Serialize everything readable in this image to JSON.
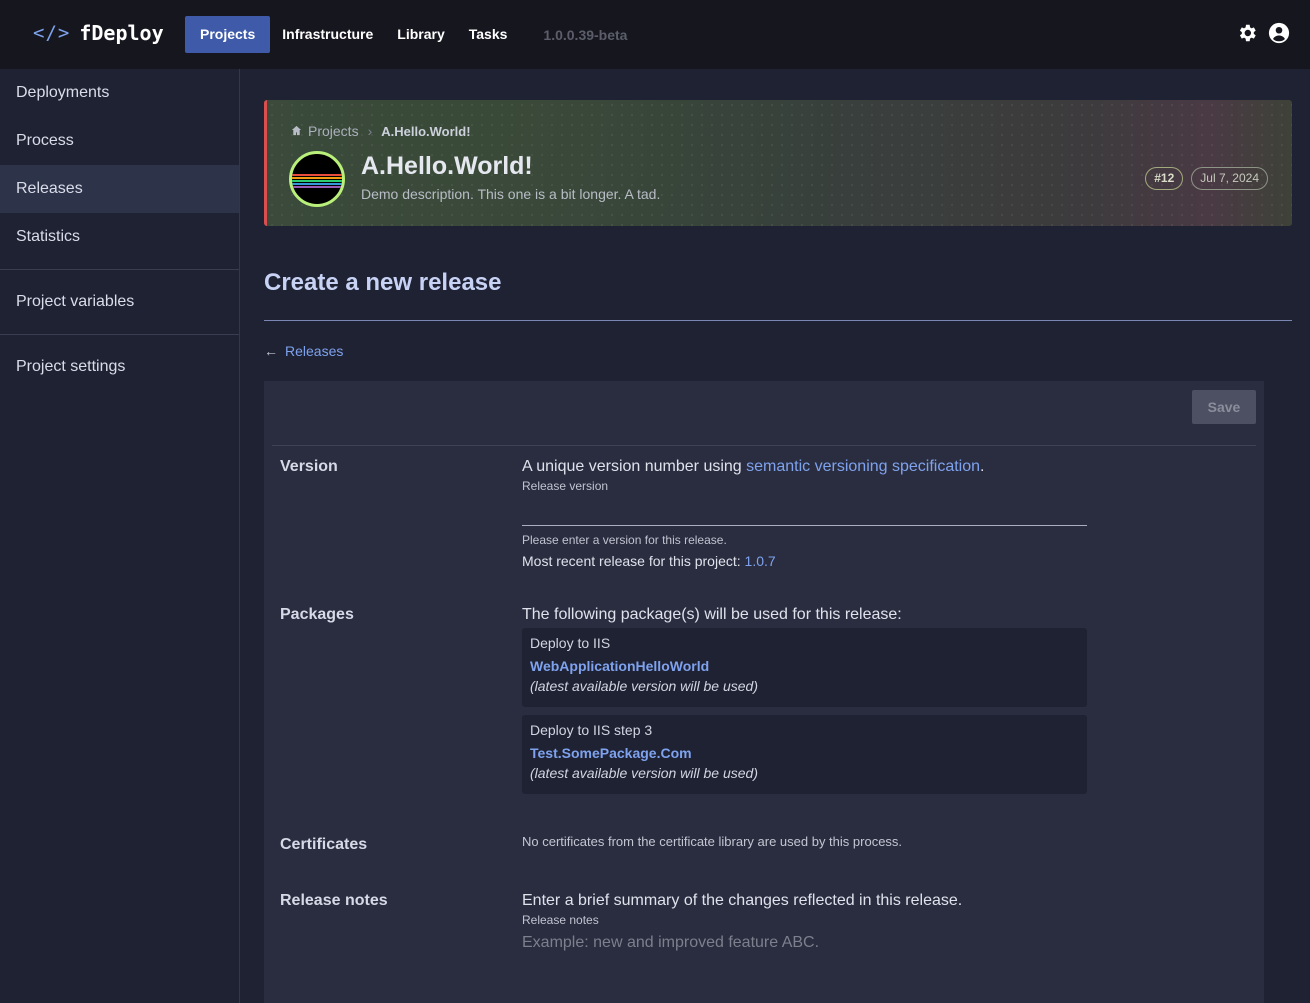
{
  "app": {
    "logo_icon": "</>",
    "name": "fDeploy",
    "version": "1.0.0.39-beta",
    "accent_color": "#3f5aa8"
  },
  "nav": {
    "items": [
      {
        "label": "Projects",
        "active": true
      },
      {
        "label": "Infrastructure",
        "active": false
      },
      {
        "label": "Library",
        "active": false
      },
      {
        "label": "Tasks",
        "active": false
      }
    ],
    "icons": [
      "gear-icon",
      "user-circle-icon"
    ]
  },
  "sidebar": {
    "items": [
      {
        "label": "Deployments"
      },
      {
        "label": "Process"
      },
      {
        "label": "Releases",
        "active": true
      },
      {
        "label": "Statistics"
      },
      {
        "label": "Project variables"
      },
      {
        "label": "Project settings"
      }
    ]
  },
  "project": {
    "breadcrumb": {
      "root": "Projects",
      "current": "A.Hello.World!"
    },
    "title": "A.Hello.World!",
    "description": "Demo description. This one is a bit longer. A tad.",
    "badge_number": "#12",
    "badge_date": "Jul 7, 2024"
  },
  "page": {
    "title": "Create a new release",
    "back_label": "Releases",
    "save_label": "Save"
  },
  "version_section": {
    "label": "Version",
    "lead_prefix": "A unique version number using ",
    "lead_link": "semantic versioning specification",
    "lead_suffix": ".",
    "field_label": "Release version",
    "field_value": "",
    "helper": "Please enter a version for this release.",
    "recent_prefix": "Most recent release for this project: ",
    "recent_version": "1.0.7"
  },
  "packages_section": {
    "label": "Packages",
    "lead": "The following package(s) will be used for this release:",
    "packages": [
      {
        "step": "Deploy to IIS",
        "name": "WebApplicationHelloWorld",
        "note": "(latest available version will be used)"
      },
      {
        "step": "Deploy to IIS step 3",
        "name": "Test.SomePackage.Com",
        "note": "(latest available version will be used)"
      }
    ]
  },
  "certificates_section": {
    "label": "Certificates",
    "text": "No certificates from the certificate library are used by this process."
  },
  "notes_section": {
    "label": "Release notes",
    "lead": "Enter a brief summary of the changes reflected in this release.",
    "field_label": "Release notes",
    "placeholder": "Example: new and improved feature ABC."
  }
}
